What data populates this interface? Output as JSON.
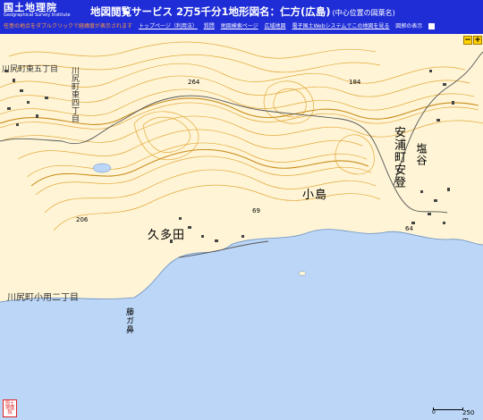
{
  "header": {
    "logo_jp": "国土地理院",
    "logo_en": "Geographical Survey Institute",
    "title": "地図閲覧サービス 2万5千分1地形図名：仁方(広島)",
    "subtitle": "(中心位置の図葉名)",
    "nav_note": "任意の地点をダブルクリックで経緯度が表示されます",
    "nav_links": [
      "トップページ（利用法）",
      "質問",
      "地図検索ページ",
      "広域地図",
      "電子国土Webシステムでこの地図を見る"
    ],
    "legend_toggle": "図郭の表示"
  },
  "map": {
    "colors": {
      "land": "#fff5d6",
      "sea": "#bcd6f7",
      "contour": "#e3a83a",
      "contour_index": "#c98c1c",
      "road": "#555555"
    },
    "places": {
      "yasuura_aso": "安浦町安登",
      "shiodani": "塩谷",
      "kojima": "小島",
      "kubota": "久多田",
      "fujigahana": "藤ガ鼻",
      "kawajiri_koyo": "川尻町小用二丁目",
      "kawajiri_higashi": "川尻町東四丁目",
      "kawajiri_higashi5": "川尻町東五丁目",
      "elev_264": "264",
      "elev_184": "184",
      "elev_69": "69",
      "elev_206": "206",
      "elev_64": "64"
    },
    "zoom_minus": "−",
    "zoom_plus": "+"
  },
  "scale": {
    "zero": "0",
    "distance": "250 m"
  },
  "stamp": {
    "text": "国土地理院"
  }
}
